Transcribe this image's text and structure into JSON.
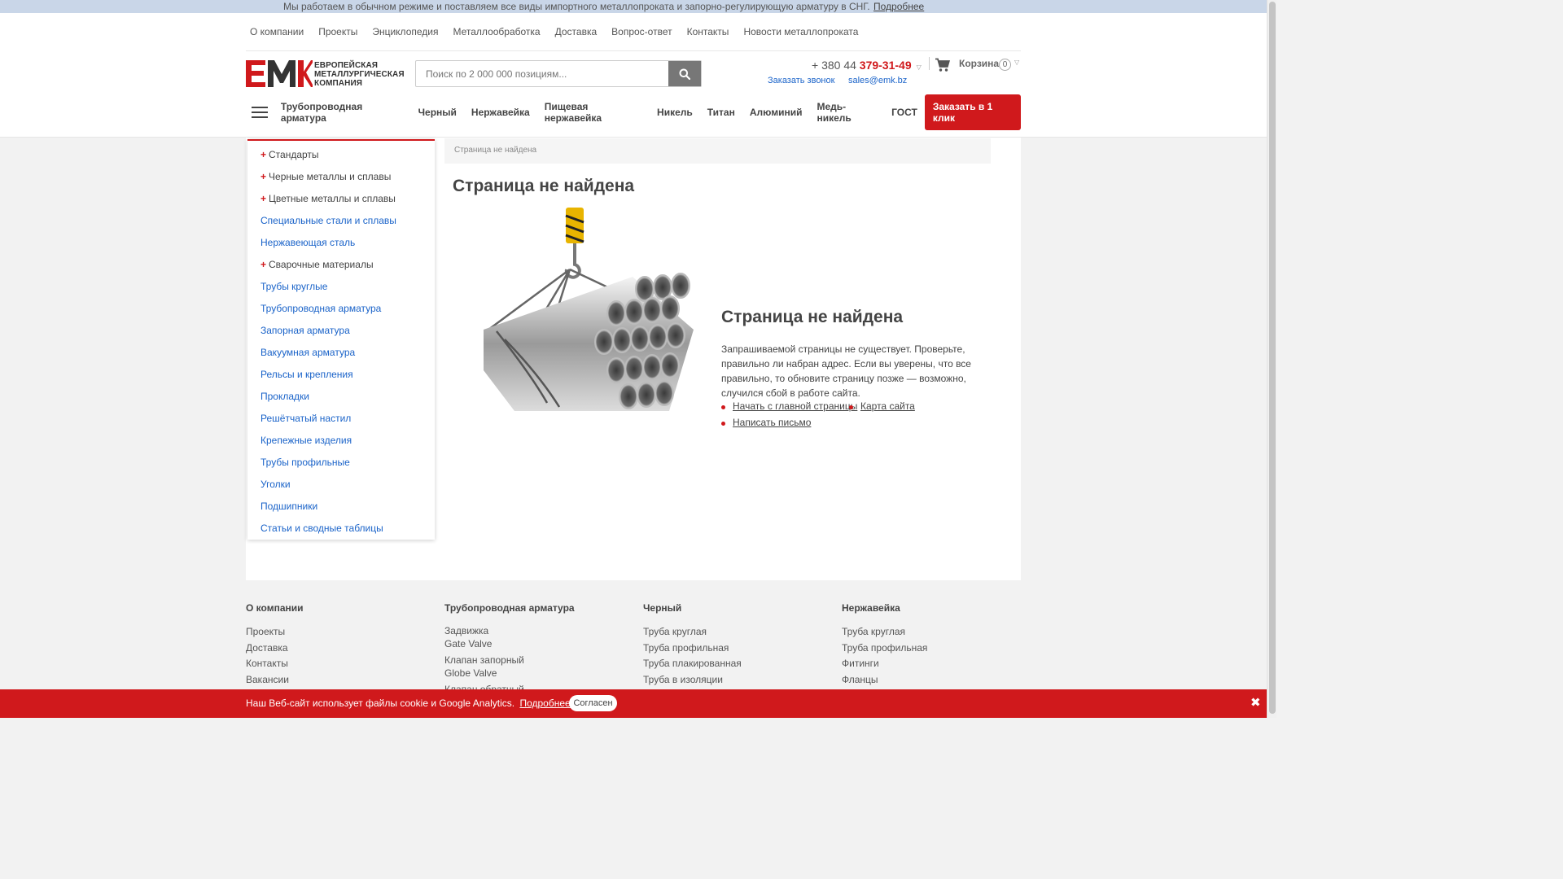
{
  "topbar": {
    "message": "Мы работаем в обычном режиме и поставляем все виды импортного металлопроката и запорно-регулирующую арматуру в СНГ.",
    "more_link": "Подробнее"
  },
  "topnav": [
    "О компании",
    "Проекты",
    "Энциклопедия",
    "Металлообработка",
    "Доставка",
    "Вопрос-ответ",
    "Контакты",
    "Новости металлопроката"
  ],
  "logo": {
    "mark": "ЕМК",
    "line1": "ЕВРОПЕЙСКАЯ",
    "line2": "МЕТАЛЛУРГИЧЕСКАЯ",
    "line3": "КОМПАНИЯ"
  },
  "search": {
    "placeholder": "Поиск по 2 000 000 позициям..."
  },
  "contact": {
    "phone_prefix": "+ 380 44 ",
    "phone_main": "379-31-49",
    "callback": "Заказать звонок",
    "email": "sales@emk.bz"
  },
  "cart": {
    "label": "Корзина",
    "count": "0"
  },
  "catnav": [
    "Трубопроводная арматура",
    "Черный",
    "Нержавейка",
    "Пищевая нержавейка",
    "Никель",
    "Титан",
    "Алюминий",
    "Медь-никель",
    "ГОСТ"
  ],
  "order_button": "Заказать в 1 клик",
  "sidebar": [
    {
      "label": "Стандарты",
      "plus": true
    },
    {
      "label": "Черные металлы и сплавы",
      "plus": true
    },
    {
      "label": "Цветные металлы и сплавы",
      "plus": true
    },
    {
      "label": "Специальные стали и сплавы",
      "plus": false
    },
    {
      "label": "Нержавеющая сталь",
      "plus": false
    },
    {
      "label": "Сварочные материалы",
      "plus": true
    },
    {
      "label": "Трубы круглые",
      "plus": false
    },
    {
      "label": "Трубопроводная арматура",
      "plus": false
    },
    {
      "label": "Запорная арматура",
      "plus": false
    },
    {
      "label": "Вакуумная арматура",
      "plus": false
    },
    {
      "label": "Рельсы и крепления",
      "plus": false
    },
    {
      "label": "Прокладки",
      "plus": false
    },
    {
      "label": "Решётчатый настил",
      "plus": false
    },
    {
      "label": "Крепежные изделия",
      "plus": false
    },
    {
      "label": "Трубы профильные",
      "plus": false
    },
    {
      "label": "Уголки",
      "plus": false
    },
    {
      "label": "Подшипники",
      "plus": false
    },
    {
      "label": "Статьи и сводные таблицы",
      "plus": false
    }
  ],
  "breadcrumb": "Страница не найдена",
  "main": {
    "title": "Страница не найдена",
    "subtitle": "Страница не найдена",
    "description": "Запрашиваемой страницы не существует. Проверьте, правильно ли набран адрес. Если вы уверены, что все правильно, то обновите страницу позже — возможно, случился сбой в работе сайта.",
    "link_home": "Начать с главной страницы",
    "link_sitemap": "Карта сайта",
    "link_write": "Написать письмо"
  },
  "footer": {
    "col1": {
      "title": "О компании",
      "items": [
        "Проекты",
        "Доставка",
        "Контакты",
        "Вакансии"
      ]
    },
    "col2": {
      "title": "Трубопроводная арматура",
      "items": [
        [
          "Задвижка",
          "Gate Valve"
        ],
        [
          "Клапан запорный",
          "Globe Valve"
        ],
        [
          "Клапан обратный",
          ""
        ]
      ]
    },
    "col3": {
      "title": "Черный",
      "items": [
        "Труба круглая",
        "Труба профильная",
        "Труба плакированная",
        "Труба в изоляции"
      ]
    },
    "col4": {
      "title": "Нержавейка",
      "items": [
        "Труба круглая",
        "Труба профильная",
        "Фитинги",
        "Фланцы"
      ]
    }
  },
  "cookie": {
    "text": "Наш Веб-сайт использует файлы cookie и Google Analytics.",
    "more": "Подробнее",
    "accept": "Согласен",
    "close": "✖"
  },
  "colors": {
    "accent": "#d0191c",
    "link": "#1a63c9",
    "topbar": "#c9d6e8"
  }
}
